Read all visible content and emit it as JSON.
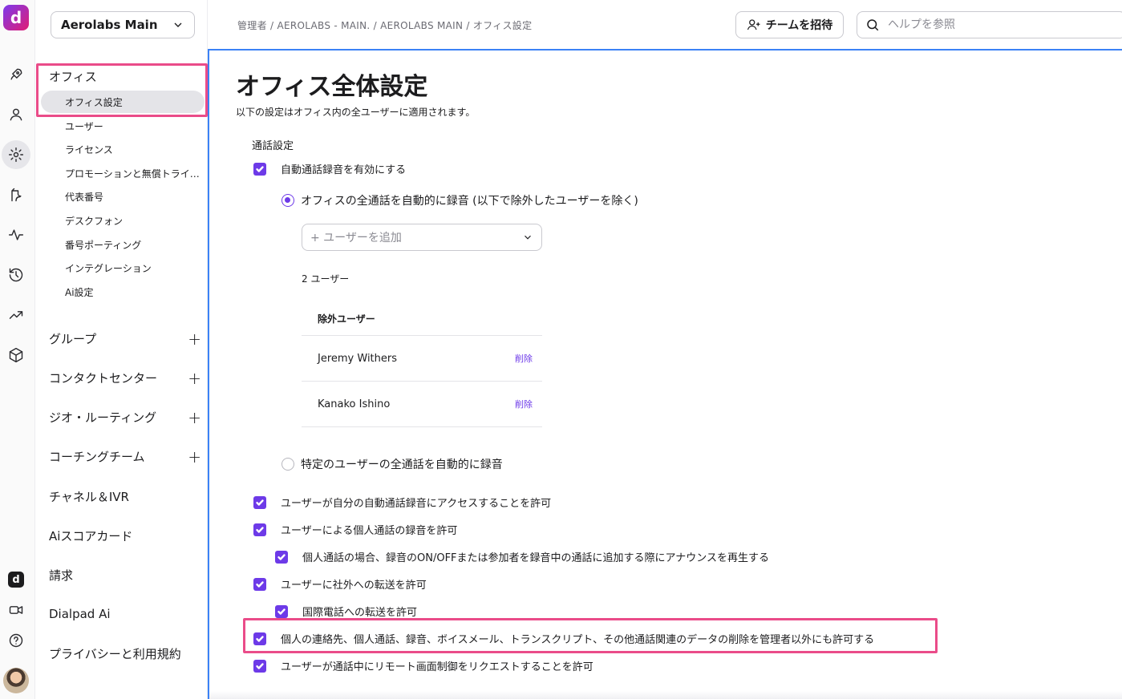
{
  "rail": {
    "logo": "d",
    "mini_logo": "d",
    "icons": [
      "rocket-icon",
      "person-icon",
      "gear-icon",
      "routing-icon",
      "activity-icon",
      "history-icon",
      "trend-icon",
      "cube-icon"
    ],
    "bottom_icons": [
      "dialpad-logo-icon",
      "video-icon",
      "help-icon"
    ]
  },
  "sidebar": {
    "org_name": "Aerolabs Main",
    "office_heading": "オフィス",
    "office_items": [
      "オフィス設定",
      "ユーザー",
      "ライセンス",
      "プロモーションと無償トライアル",
      "代表番号",
      "デスクフォン",
      "番号ポーティング",
      "インテグレーション",
      "Ai設定"
    ],
    "groups": [
      "グループ",
      "コンタクトセンター",
      "ジオ・ルーティング",
      "コーチングチーム",
      "チャネル＆IVR",
      "Aiスコアカード",
      "請求",
      "Dialpad Ai",
      "プライバシーと利用規約"
    ],
    "plus": "+"
  },
  "topbar": {
    "breadcrumb": "管理者 / AEROLABS - MAIN. / AEROLABS MAIN / オフィス設定",
    "invite_label": "チームを招待",
    "help_placeholder": "ヘルプを参照"
  },
  "main": {
    "title": "オフィス全体設定",
    "description": "以下の設定はオフィス内の全ユーザーに適用されます。",
    "section_title": "通話設定",
    "auto_record": "自動通話録音を有効にする",
    "radio_all": "オフィスの全通話を自動的に録音 (以下で除外したユーザーを除く)",
    "add_user_placeholder": "+ ユーザーを追加",
    "user_count": "2 ユーザー",
    "excluded_header": "除外ユーザー",
    "excluded_users": [
      {
        "name": "Jeremy Withers",
        "action": "削除"
      },
      {
        "name": "Kanako Ishino",
        "action": "削除"
      }
    ],
    "radio_specific": "特定のユーザーの全通話を自動的に録音",
    "options": [
      "ユーザーが自分の自動通話録音にアクセスすることを許可",
      "ユーザーによる個人通話の録音を許可",
      "個人通話の場合、録音のON/OFFまたは参加者を録音中の通話に追加する際にアナウンスを再生する",
      "ユーザーに社外への転送を許可",
      "国際電話への転送を許可",
      "個人の連絡先、個人通話、録音、ボイスメール、トランスクリプト、その他通話関連のデータの削除を管理者以外にも許可する",
      "ユーザーが通話中にリモート画面制御をリクエストすることを許可"
    ]
  },
  "colors": {
    "accent": "#6d3ae8",
    "highlight": "#ea4c89",
    "focus": "#3b82f6"
  }
}
